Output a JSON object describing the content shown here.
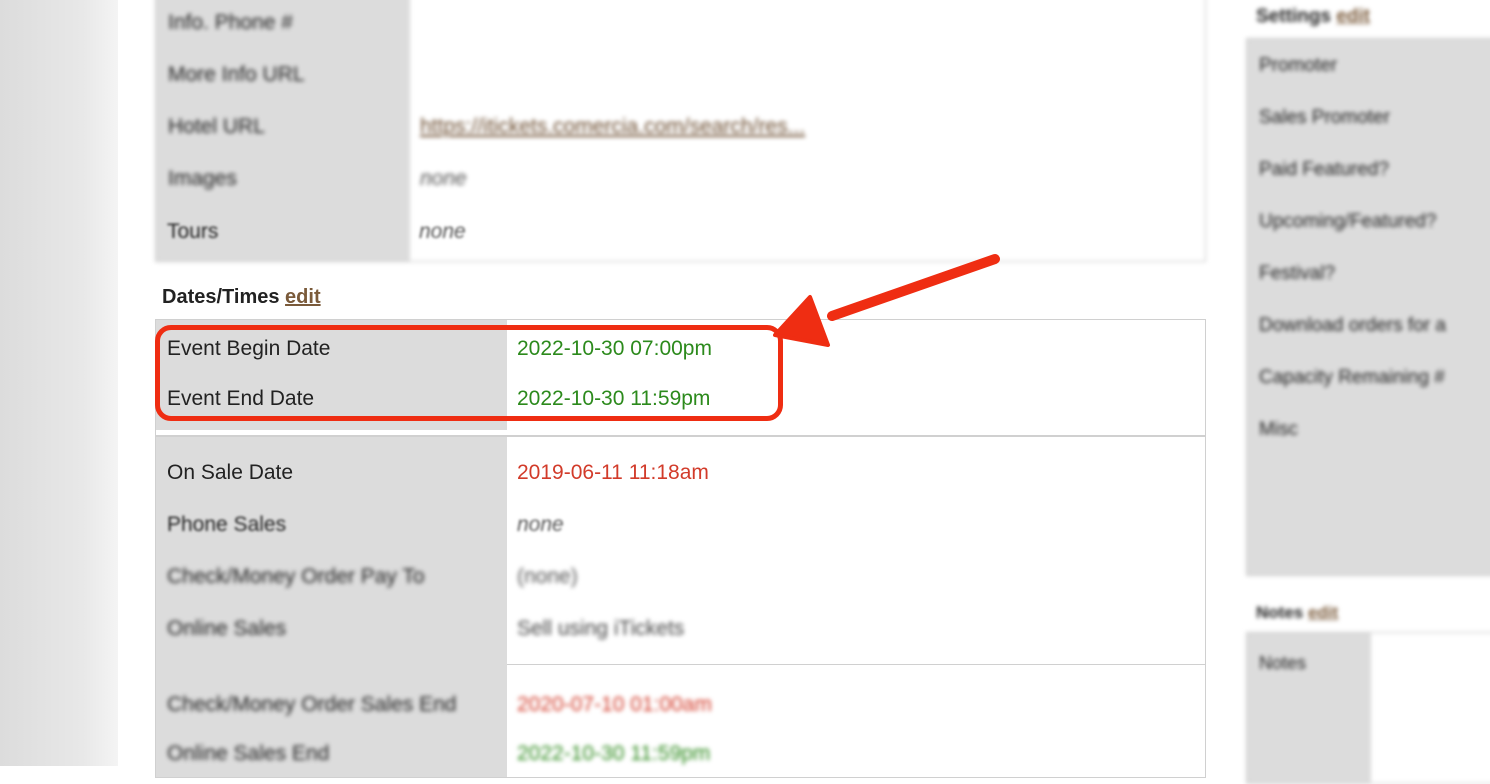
{
  "info_table": {
    "rows": [
      {
        "label": "Info. Phone #",
        "value": ""
      },
      {
        "label": "More Info URL",
        "value": ""
      },
      {
        "label": "Hotel URL",
        "value": "https://itickets.comercia.com/search/res..."
      },
      {
        "label": "Images",
        "value": "none"
      },
      {
        "label": "Tours",
        "value": "none"
      }
    ]
  },
  "dates": {
    "title": "Dates/Times",
    "edit_label": "edit",
    "event_begin_label": "Event Begin Date",
    "event_begin_value": "2022-10-30 07:00pm",
    "event_end_label": "Event End Date",
    "event_end_value": "2022-10-30 11:59pm"
  },
  "sales": {
    "rows": [
      {
        "label": "On Sale Date",
        "value": "2019-06-11 11:18am"
      },
      {
        "label": "Phone Sales",
        "value": "none"
      },
      {
        "label": "Check/Money Order Pay To",
        "value": "(none)"
      },
      {
        "label": "Online Sales",
        "value": "Sell using iTickets"
      }
    ],
    "end_rows": [
      {
        "label": "Check/Money Order Sales End",
        "value": "2020-07-10 01:00am"
      },
      {
        "label": "Online Sales End",
        "value": "2022-10-30 11:59pm"
      }
    ]
  },
  "settings": {
    "title": "Settings",
    "edit_label": "edit",
    "items": [
      "Promoter",
      "Sales Promoter",
      "Paid Featured?",
      "Upcoming/Featured?",
      "Festival?",
      "Download orders for a",
      "Capacity Remaining #",
      "Misc"
    ]
  },
  "notes": {
    "title": "Notes",
    "edit_label": "edit",
    "label": "Notes"
  },
  "colors": {
    "highlight": "#ef2d12",
    "green_value": "#2c8a1c",
    "red_value": "#d23b2a",
    "label_bg": "#dcdcdc"
  }
}
